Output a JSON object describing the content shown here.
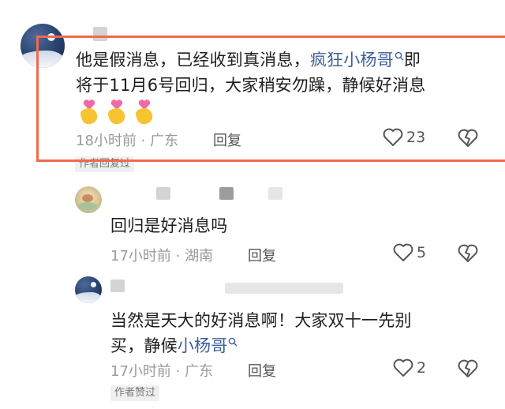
{
  "comments": [
    {
      "text_before": "他是假消息，已经收到真消息，",
      "mention": "疯狂小杨哥",
      "text_after_line1": "即",
      "text_line2": "将于11月6号回归，大家稍安勿躁，静候好消息",
      "emoji": [
        "💘🤞",
        "💘🤞",
        "💘🤞"
      ],
      "time": "18小时前",
      "location": "广东",
      "reply_label": "回复",
      "likes": "23",
      "badge": "作者回复过"
    },
    {
      "text": "回归是好消息吗",
      "time": "17小时前",
      "location": "湖南",
      "reply_label": "回复",
      "likes": "5"
    },
    {
      "text_line1": "当然是天大的好消息啊！大家双十一先别",
      "text_line2_before": "买，静候",
      "mention": "小杨哥",
      "time": "17小时前",
      "location": "广东",
      "reply_label": "回复",
      "likes": "2",
      "badge": "作者赞过"
    }
  ],
  "colors": {
    "highlight": "#ee6b4d",
    "mention": "#3f5f9b"
  },
  "icons": [
    "heart-outline-icon",
    "heart-break-icon",
    "search-icon",
    "pink-heart-emoji",
    "fingers-crossed-emoji"
  ]
}
